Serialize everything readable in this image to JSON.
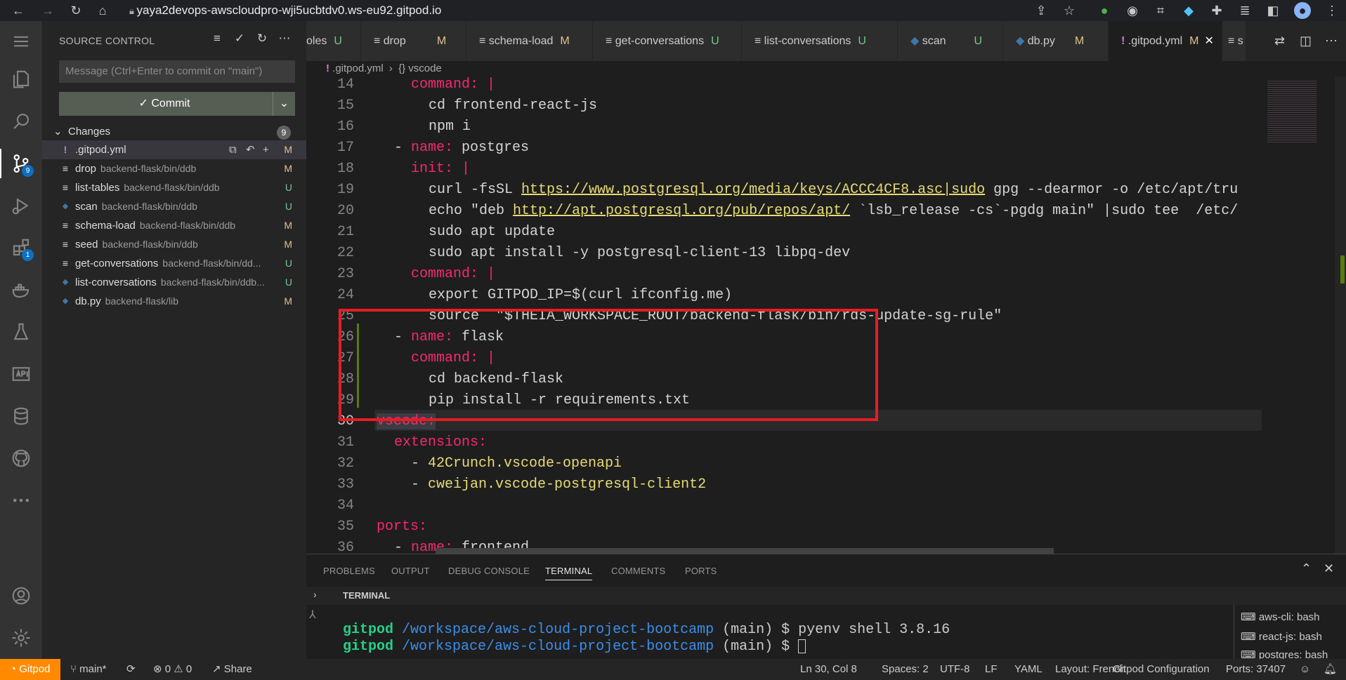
{
  "browser": {
    "url": "yaya2devops-awscloudpro-wji5ucbtdv0.ws-eu92.gitpod.io"
  },
  "activity_badges": {
    "scm": "9",
    "extensions": "1"
  },
  "sidebar": {
    "title": "SOURCE CONTROL",
    "message_placeholder": "Message (Ctrl+Enter to commit on \"main\")",
    "commit_label": "Commit",
    "changes_label": "Changes",
    "changes_count": "9",
    "files": [
      {
        "name": ".gitpod.yml",
        "path": "",
        "status": "M",
        "icon": "!"
      },
      {
        "name": "drop",
        "path": "backend-flask/bin/ddb",
        "status": "M",
        "icon": "≡"
      },
      {
        "name": "list-tables",
        "path": "backend-flask/bin/ddb",
        "status": "U",
        "icon": "≡"
      },
      {
        "name": "scan",
        "path": "backend-flask/bin/ddb",
        "status": "U",
        "icon": "py"
      },
      {
        "name": "schema-load",
        "path": "backend-flask/bin/ddb",
        "status": "M",
        "icon": "≡"
      },
      {
        "name": "seed",
        "path": "backend-flask/bin/ddb",
        "status": "M",
        "icon": "≡"
      },
      {
        "name": "get-conversations",
        "path": "backend-flask/bin/dd...",
        "status": "U",
        "icon": "≡"
      },
      {
        "name": "list-conversations",
        "path": "backend-flask/bin/ddb...",
        "status": "U",
        "icon": "py"
      },
      {
        "name": "db.py",
        "path": "backend-flask/lib",
        "status": "M",
        "icon": "py"
      }
    ]
  },
  "tabs": [
    {
      "label": "oles",
      "status": "U"
    },
    {
      "label": "drop",
      "status": "M"
    },
    {
      "label": "schema-load",
      "status": "M"
    },
    {
      "label": "get-conversations",
      "status": "U"
    },
    {
      "label": "list-conversations",
      "status": "U"
    },
    {
      "label": "scan",
      "status": "U"
    },
    {
      "label": "db.py",
      "status": "M"
    },
    {
      "label": ".gitpod.yml",
      "status": "M"
    },
    {
      "label": "s",
      "status": ""
    }
  ],
  "breadcrumb": {
    "file": ".gitpod.yml",
    "symbol": "vscode"
  },
  "editor": {
    "line_numbers": [
      "14",
      "15",
      "16",
      "17",
      "18",
      "19",
      "20",
      "21",
      "22",
      "23",
      "24",
      "25",
      "26",
      "27",
      "28",
      "29",
      "30",
      "31",
      "32",
      "33",
      "34",
      "35",
      "36"
    ],
    "lines": {
      "l14_key": "command:",
      "l14_rest": " |",
      "l15": "cd frontend-react-js",
      "l16": "npm i",
      "l17_key": "name:",
      "l17_val": " postgres",
      "l18_key": "init:",
      "l18_rest": " |",
      "l19_a": "curl -fsSL ",
      "l19_url": "https://www.postgresql.org/media/keys/ACCC4CF8.asc|sudo",
      "l19_b": " gpg --dearmor -o /etc/apt/tru",
      "l20_a": "echo \"deb ",
      "l20_url": "http://apt.postgresql.org/pub/repos/apt/",
      "l20_b": " `lsb_release -cs`-pgdg main\" |sudo tee  /etc/",
      "l21": "sudo apt update",
      "l22": "sudo apt install -y postgresql-client-13 libpq-dev",
      "l23_key": "command:",
      "l23_rest": " |",
      "l24": "export GITPOD_IP=$(curl ifconfig.me)",
      "l25": "source  \"$THEIA_WORKSPACE_ROOT/backend-flask/bin/rds-update-sg-rule\"",
      "l26_key": "name:",
      "l26_val": " flask",
      "l27_key": "command:",
      "l27_rest": " |",
      "l28": "cd backend-flask",
      "l29": "pip install -r requirements.txt",
      "l30": "vscode:",
      "l31": "extensions:",
      "l32": "42Crunch.vscode-openapi",
      "l33": "cweijan.vscode-postgresql-client2",
      "l35": "ports:",
      "l36_key": "name:",
      "l36_val": " frontend"
    }
  },
  "panel": {
    "tabs": [
      "PROBLEMS",
      "OUTPUT",
      "DEBUG CONSOLE",
      "TERMINAL",
      "COMMENTS",
      "PORTS"
    ],
    "section": "TERMINAL",
    "term_user": "gitpod",
    "term_path": "/workspace/aws-cloud-project-bootcamp",
    "term_line1": " (main) $ pyenv shell 3.8.16",
    "term_line2": " (main) $ ",
    "terminals": [
      "aws-cli: bash",
      "react-js: bash",
      "postgres: bash"
    ]
  },
  "status": {
    "gitpod": "Gitpod",
    "branch": "main*",
    "errors": "0",
    "warnings": "0",
    "share": "Share",
    "position": "Ln 30, Col 8",
    "spaces": "Spaces: 2",
    "encoding": "UTF-8",
    "eol": "LF",
    "language": "YAML",
    "layout": "Layout: French",
    "config": "Gitpod Configuration",
    "ports": "Ports: 37407"
  }
}
